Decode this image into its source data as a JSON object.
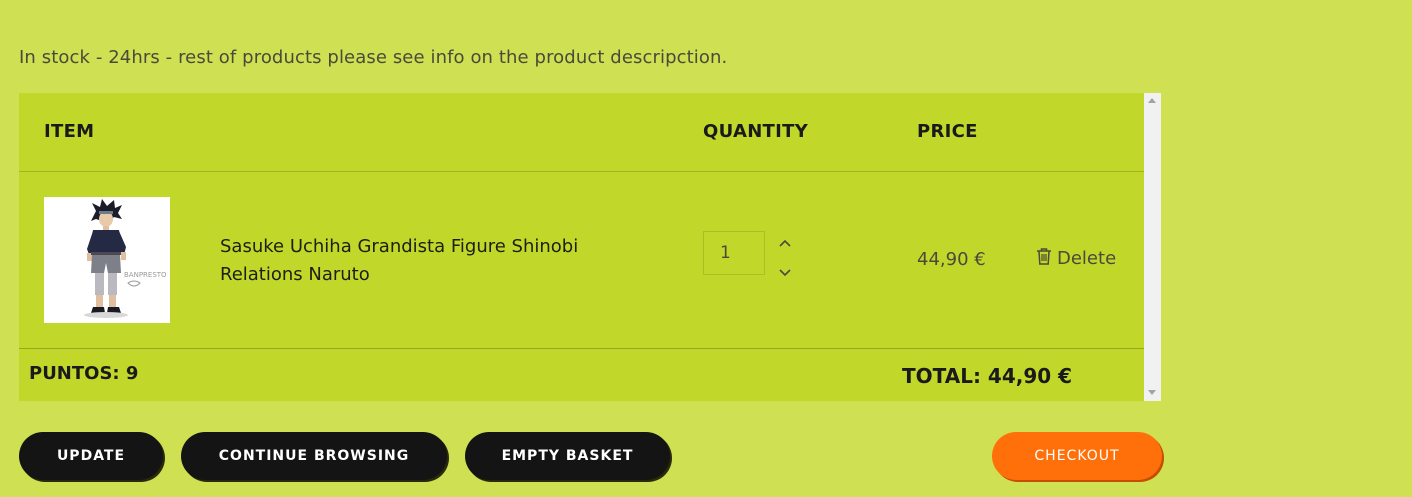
{
  "stock_note": "In stock - 24hrs - rest of products please see info on the product descripction.",
  "table": {
    "headers": {
      "item": "ITEM",
      "quantity": "QUANTITY",
      "price": "PRICE"
    },
    "rows": [
      {
        "product_name": "Sasuke Uchiha Grandista Figure Shinobi Relations Naruto",
        "quantity": "1",
        "price": "44,90 €",
        "delete_label": "Delete",
        "thumbnail_logo_text": "BANPRESTO"
      }
    ],
    "points": "PUNTOS: 9",
    "total": "TOTAL: 44,90 €"
  },
  "actions": {
    "update": "UPDATE",
    "continue_browsing": "CONTINUE BROWSING",
    "empty_basket": "EMPTY BASKET",
    "checkout": "CHECKOUT"
  },
  "icons": {
    "delete": "trash-icon",
    "qty_increase": "chevron-up-icon",
    "qty_decrease": "chevron-down-icon"
  },
  "colors": {
    "page_background": "#cfe053",
    "table_background": "#c1d82b",
    "primary_button": "#141414",
    "checkout_button": "#ff6f0a"
  }
}
